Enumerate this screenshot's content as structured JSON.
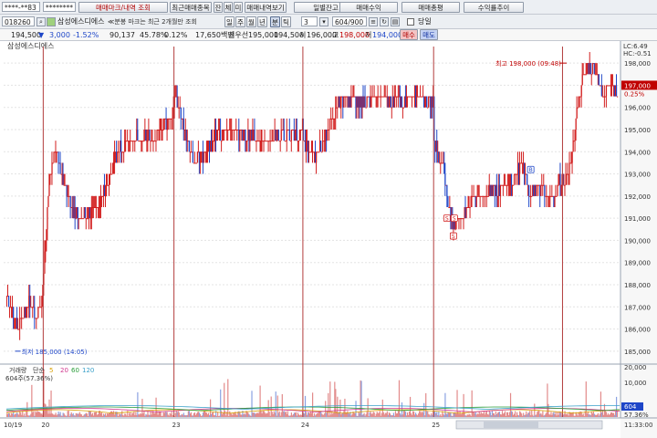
{
  "toolbar1": {
    "account_id": "****-**83",
    "password_mask": "********",
    "trade_mark_btn": "매매마크/내역 조회",
    "recent_trade_btn": "최근매매종목",
    "balance_btn": "잔",
    "contract_btn": "체",
    "history_btn": "미",
    "trade_detail_btn": "매매내역보기",
    "daily_balance_btn": "일별잔고",
    "trade_profit_btn": "매매수익",
    "trade_total_btn": "매매총평",
    "profit_trend_btn": "수익률추이"
  },
  "toolbar2": {
    "stock_code": "018260",
    "stock_name": "삼성에스디에스",
    "info_text": "≪분봉 마크는 최근 2개월만 조회",
    "period_tabs": [
      "일",
      "주",
      "월",
      "년",
      "분",
      "틱"
    ],
    "active_period_tab": "분",
    "minute_value": "3",
    "bar_count": "604/900",
    "today_label": "당일"
  },
  "quote": {
    "price": "194,500",
    "arrow": "▼",
    "change": "3,000",
    "change_pct": "-1.52%",
    "volume": "90,137",
    "ratio1": "45.78%",
    "ratio2": "0.12%",
    "amount": "17,650백만",
    "ask_label": "최우선",
    "ask": "195,000",
    "bid": "194,500",
    "open_label": "시",
    "open": "196,000",
    "high_label": "고",
    "high": "198,000",
    "low_label": "저",
    "low": "194,000",
    "buy_btn": "매수",
    "sell_btn": "매도"
  },
  "chart_data": {
    "type": "candlestick",
    "title": "삼성에스디에스",
    "lc_label": "LC:6.49",
    "hc_label": "HC:-0.51",
    "current_price_label": "197,000",
    "current_pct_label": "0.25%",
    "y_ticks": [
      "198,000",
      "197,000",
      "196,000",
      "195,000",
      "194,000",
      "193,000",
      "192,000",
      "191,000",
      "190,000",
      "189,000",
      "188,000",
      "187,000",
      "186,000",
      "185,000"
    ],
    "ylim": [
      184500,
      198500
    ],
    "x_ticks": [
      "10/19",
      "20",
      "23",
      "24",
      "25",
      "26"
    ],
    "annotations": {
      "high": "최고 198,000 (09:48)",
      "low": "최저 185,000 (14:05)"
    },
    "trade_markers": [
      {
        "label": "S",
        "index": 478,
        "price": 191000
      },
      {
        "label": "S",
        "index": 486,
        "price": 191000
      },
      {
        "label": "S",
        "index": 485,
        "price": 190200
      },
      {
        "label": "B",
        "index": 569,
        "price": 193200
      }
    ],
    "segments": [
      {
        "n": 40,
        "pts": [
          [
            0,
            187.5
          ],
          [
            6,
            186.8
          ],
          [
            12,
            185.9
          ],
          [
            18,
            186.6
          ],
          [
            24,
            187.3
          ],
          [
            32,
            186.6
          ],
          [
            40,
            187.7
          ]
        ]
      },
      {
        "n": 142,
        "pts": [
          [
            0,
            188.5
          ],
          [
            6,
            193.0
          ],
          [
            12,
            194.2
          ],
          [
            22,
            192.5
          ],
          [
            34,
            191.2
          ],
          [
            48,
            191.0
          ],
          [
            64,
            192.0
          ],
          [
            82,
            194.2
          ],
          [
            100,
            194.6
          ],
          [
            120,
            194.5
          ],
          [
            142,
            195.9
          ]
        ]
      },
      {
        "n": 140,
        "pts": [
          [
            0,
            196.5
          ],
          [
            10,
            195.2
          ],
          [
            20,
            193.5
          ],
          [
            32,
            193.8
          ],
          [
            44,
            194.8
          ],
          [
            60,
            195.0
          ],
          [
            76,
            194.8
          ],
          [
            96,
            194.6
          ],
          [
            116,
            194.6
          ],
          [
            130,
            194.8
          ],
          [
            140,
            194.8
          ]
        ]
      },
      {
        "n": 142,
        "pts": [
          [
            0,
            194.5
          ],
          [
            14,
            193.8
          ],
          [
            30,
            195.4
          ],
          [
            42,
            196.4
          ],
          [
            62,
            196.3
          ],
          [
            80,
            196.5
          ],
          [
            100,
            196.2
          ],
          [
            120,
            196.5
          ],
          [
            142,
            196.2
          ]
        ]
      },
      {
        "n": 140,
        "pts": [
          [
            0,
            194.4
          ],
          [
            8,
            193.6
          ],
          [
            14,
            192.1
          ],
          [
            20,
            190.6
          ],
          [
            30,
            191.0
          ],
          [
            40,
            191.9
          ],
          [
            54,
            192.0
          ],
          [
            70,
            192.3
          ],
          [
            86,
            192.8
          ],
          [
            96,
            193.6
          ],
          [
            104,
            192.2
          ],
          [
            116,
            192.3
          ],
          [
            130,
            191.7
          ],
          [
            140,
            193.2
          ]
        ]
      },
      {
        "n": 60,
        "pts": [
          [
            0,
            192.6
          ],
          [
            8,
            193.4
          ],
          [
            16,
            196.2
          ],
          [
            24,
            197.6
          ],
          [
            32,
            197.8
          ],
          [
            42,
            196.6
          ],
          [
            52,
            197.1
          ],
          [
            60,
            196.6
          ]
        ]
      }
    ],
    "volume_panel": {
      "legend_label": "거래량",
      "ma_label": "단순",
      "ma_periods": [
        "5",
        "20",
        "60",
        "120"
      ],
      "volume_text": "604주(57.36%)",
      "y_ticks": [
        "20,000",
        "10,000",
        "0"
      ],
      "current_value": "604",
      "current_pct": "57.36%"
    },
    "time_label": "11:33:00",
    "grid": true
  },
  "colors": {
    "up": "#d21e1e",
    "down": "#1e46c8",
    "session_line": "#b23c3c",
    "price_tag": "#c00000"
  }
}
